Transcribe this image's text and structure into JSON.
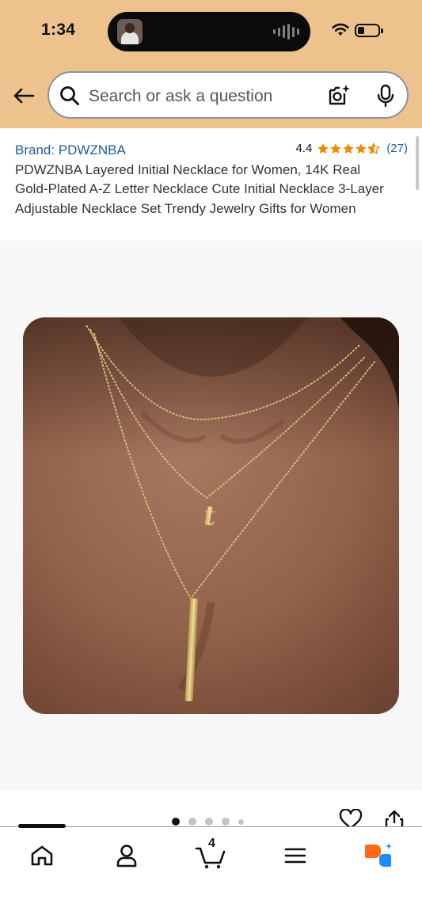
{
  "status_bar": {
    "time": "1:34"
  },
  "search": {
    "placeholder": "Search or ask a question"
  },
  "product": {
    "brand": "Brand: PDWZNBA",
    "rating": "4.4",
    "stars_value": 4.4,
    "review_count": "(27)",
    "title": "PDWZNBA Layered Initial Necklace for Women, 14K Real Gold-Plated A-Z Letter Necklace Cute Initial Necklace 3-Layer Adjustable Necklace Set Trendy Jewelry Gifts for Women"
  },
  "gallery": {
    "image_count": 5,
    "active_index": 0
  },
  "cart": {
    "count": "4"
  },
  "colors": {
    "header": "#eec28d",
    "link": "#1f5c99",
    "star": "#f08804",
    "rufus_orange": "#ff6a1a",
    "rufus_blue": "#1a8cff"
  },
  "icons": [
    "back-arrow-icon",
    "search-icon",
    "camera-icon",
    "mic-icon",
    "heart-icon",
    "share-icon",
    "home-icon",
    "account-icon",
    "cart-icon",
    "menu-icon",
    "rufus-icon"
  ]
}
